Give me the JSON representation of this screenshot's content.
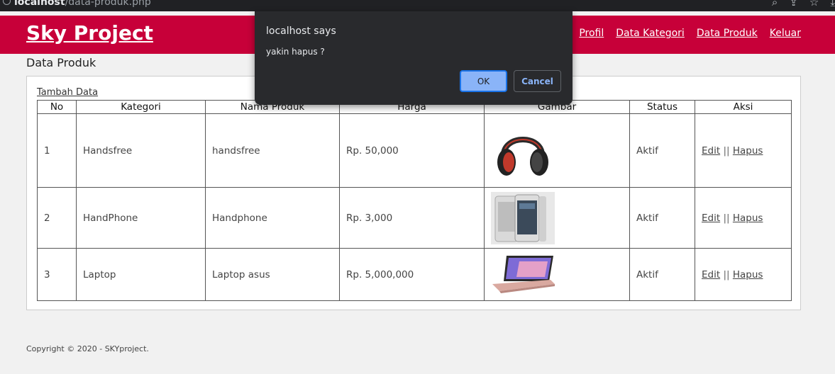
{
  "browser": {
    "url_host": "localhost",
    "url_path": "/data-produk.php"
  },
  "header": {
    "brand": "Sky Project",
    "nav": [
      "Profil",
      "Data Kategori",
      "Data Produk",
      "Keluar"
    ]
  },
  "page": {
    "title": "Data Produk",
    "add_link": "Tambah Data"
  },
  "table": {
    "headers": [
      "No",
      "Kategori",
      "Nama Produk",
      "Harga",
      "Gambar",
      "Status",
      "Aksi"
    ],
    "rows": [
      {
        "no": "1",
        "kategori": "Handsfree",
        "nama": "handsfree",
        "harga": "Rp. 50,000",
        "gambar": "headphones-image",
        "status": "Aktif"
      },
      {
        "no": "2",
        "kategori": "HandPhone",
        "nama": "Handphone",
        "harga": "Rp. 3,000",
        "gambar": "smartphone-image",
        "status": "Aktif"
      },
      {
        "no": "3",
        "kategori": "Laptop",
        "nama": "Laptop asus",
        "harga": "Rp. 5,000,000",
        "gambar": "laptop-image",
        "status": "Aktif"
      }
    ],
    "action_edit": "Edit",
    "action_sep": "||",
    "action_delete": "Hapus"
  },
  "footer": {
    "copyright": "Copyright © 2020 - SKYproject."
  },
  "dialog": {
    "title": "localhost says",
    "message": "yakin hapus ?",
    "ok_label": "OK",
    "cancel_label": "Cancel"
  },
  "colors": {
    "header_bg": "#c70039",
    "dialog_bg": "#292a2d",
    "ok_button": "#8ab4f8"
  }
}
